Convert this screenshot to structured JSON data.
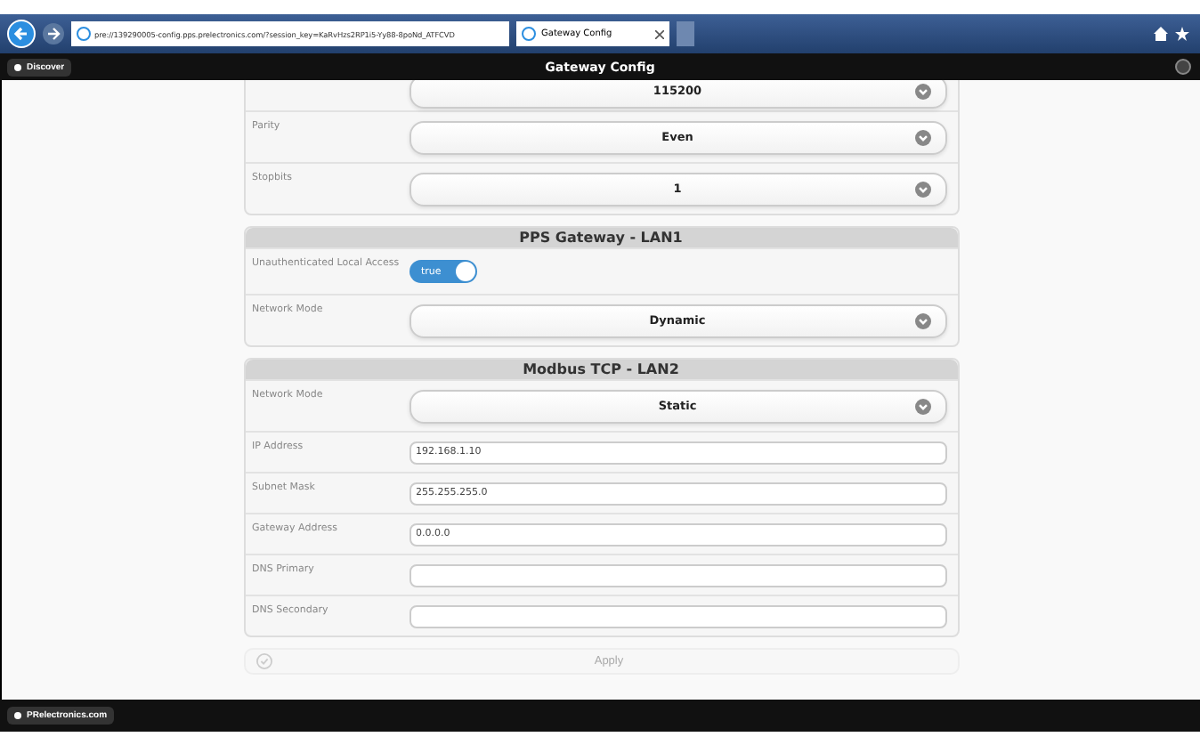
{
  "browser": {
    "address": "pre://139290005-config.pps.prelectronics.com/?session_key=KaRvHzs2RP1i5-Yy88-8poNd_ATFCVD",
    "tab_title": "Gateway Config"
  },
  "header": {
    "button": "Discover",
    "title": "Gateway Config"
  },
  "sections": [
    {
      "rows": [
        {
          "kind": "select",
          "value": "115200"
        },
        {
          "kind": "select",
          "label": "Parity",
          "value": "Even"
        },
        {
          "kind": "select",
          "label": "Stopbits",
          "value": "1"
        }
      ]
    },
    {
      "title": "PPS Gateway - LAN1",
      "rows": [
        {
          "kind": "toggle",
          "label": "Unauthenticated Local Access",
          "value": "true",
          "on": true
        },
        {
          "kind": "select",
          "label": "Network Mode",
          "value": "Dynamic"
        }
      ]
    },
    {
      "title": "Modbus TCP - LAN2",
      "rows": [
        {
          "kind": "select",
          "label": "Network Mode",
          "value": "Static"
        },
        {
          "kind": "input",
          "label": "IP Address",
          "value": "192.168.1.10"
        },
        {
          "kind": "input",
          "label": "Subnet Mask",
          "value": "255.255.255.0"
        },
        {
          "kind": "input",
          "label": "Gateway Address",
          "value": "0.0.0.0"
        },
        {
          "kind": "input",
          "label": "DNS Primary"
        },
        {
          "kind": "input",
          "label": "DNS Secondary"
        }
      ]
    }
  ],
  "apply_button": {
    "label": "Apply",
    "disabled": true
  },
  "footer": {
    "button": "PRelectronics.com"
  }
}
